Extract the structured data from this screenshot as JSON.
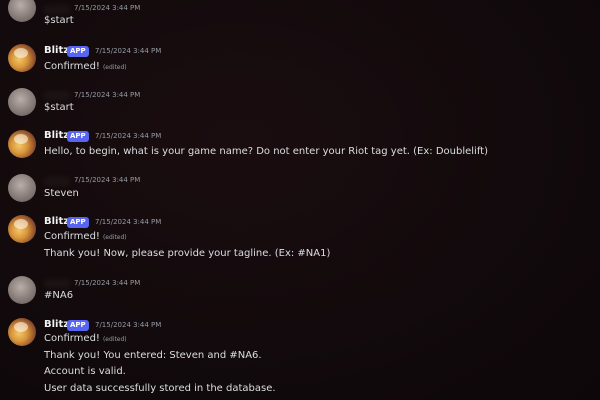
{
  "messages": [
    {
      "author": "",
      "timestamp": "7/15/2024 3:44 PM",
      "lines": [
        "$start"
      ]
    },
    {
      "author": "Blitz",
      "badge": "APP",
      "timestamp": "7/15/2024 3:44 PM",
      "lines": [
        "Confirmed!"
      ],
      "edited": "(edited)"
    },
    {
      "author": "",
      "timestamp": "7/15/2024 3:44 PM",
      "lines": [
        "$start"
      ]
    },
    {
      "author": "Blitz",
      "badge": "APP",
      "timestamp": "7/15/2024 3:44 PM",
      "lines": [
        "Hello, to begin, what is your game name? Do not enter your Riot tag yet. (Ex: Doublelift)"
      ]
    },
    {
      "author": "",
      "timestamp": "7/15/2024 3:44 PM",
      "lines": [
        "Steven"
      ]
    },
    {
      "author": "Blitz",
      "badge": "APP",
      "timestamp": "7/15/2024 3:44 PM",
      "lines": [
        "Confirmed!",
        "Thank you! Now, please provide your tagline. (Ex: #NA1)"
      ],
      "edited": "(edited)"
    },
    {
      "author": "",
      "timestamp": "7/15/2024 3:44 PM",
      "lines": [
        "#NA6"
      ]
    },
    {
      "author": "Blitz",
      "badge": "APP",
      "timestamp": "7/15/2024 3:44 PM",
      "lines": [
        "Confirmed!",
        "Thank you! You entered: Steven and #NA6.",
        "Account is valid.",
        "User data successfully stored in the database."
      ],
      "edited": "(edited)"
    }
  ]
}
